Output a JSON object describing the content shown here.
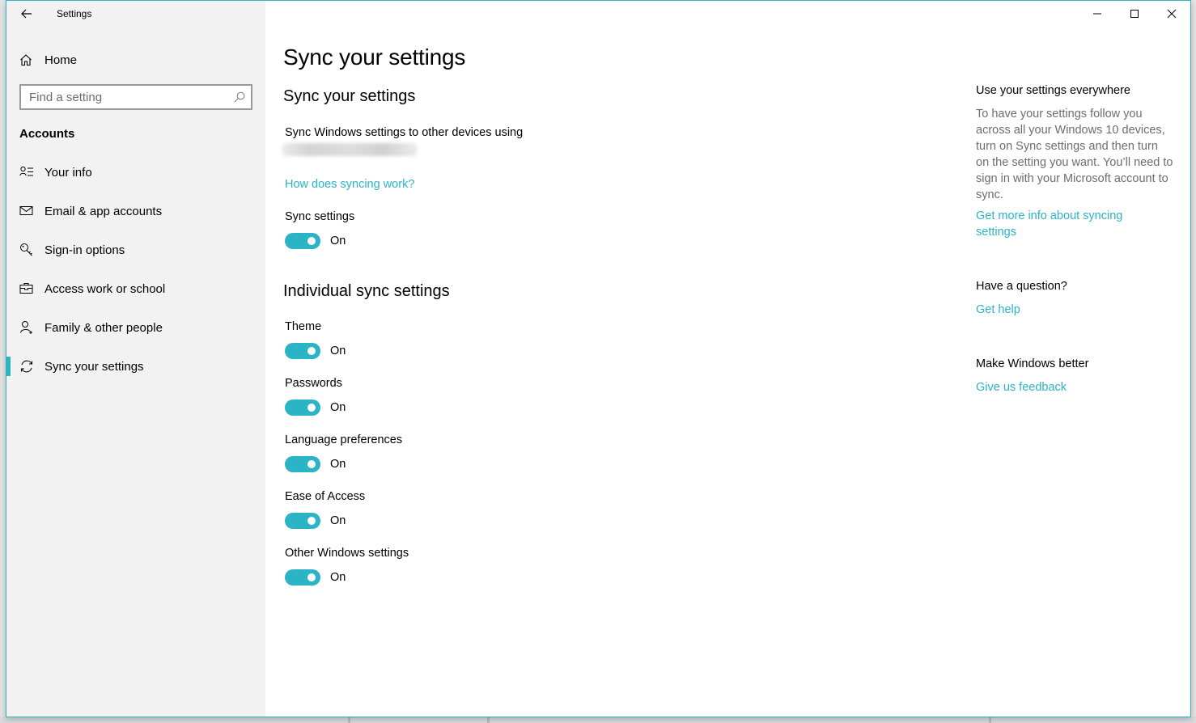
{
  "window": {
    "title": "Settings",
    "controls": {
      "minimize": "minimize-icon",
      "maximize": "maximize-icon",
      "close": "close-icon"
    }
  },
  "colors": {
    "accent": "#2bb3c6",
    "sidebar_bg": "#f2f2f2",
    "secondary_text": "#6d6d6d"
  },
  "sidebar": {
    "home_label": "Home",
    "search_placeholder": "Find a setting",
    "section_label": "Accounts",
    "items": [
      {
        "label": "Your info",
        "icon": "person-list-icon",
        "active": false
      },
      {
        "label": "Email & app accounts",
        "icon": "envelope-icon",
        "active": false
      },
      {
        "label": "Sign-in options",
        "icon": "key-icon",
        "active": false
      },
      {
        "label": "Access work or school",
        "icon": "briefcase-icon",
        "active": false
      },
      {
        "label": "Family & other people",
        "icon": "person-add-icon",
        "active": false
      },
      {
        "label": "Sync your settings",
        "icon": "sync-icon",
        "active": true
      }
    ]
  },
  "main": {
    "page_title": "Sync your settings",
    "sync_section": {
      "heading": "Sync your settings",
      "description": "Sync Windows settings to other devices using",
      "account_email": "[redacted / blurred]",
      "help_link": "How does syncing work?",
      "sync_settings": {
        "label": "Sync settings",
        "state": "On",
        "on": true
      }
    },
    "individual_section": {
      "heading": "Individual sync settings",
      "items": [
        {
          "label": "Theme",
          "state": "On",
          "on": true
        },
        {
          "label": "Passwords",
          "state": "On",
          "on": true
        },
        {
          "label": "Language preferences",
          "state": "On",
          "on": true
        },
        {
          "label": "Ease of Access",
          "state": "On",
          "on": true
        },
        {
          "label": "Other Windows settings",
          "state": "On",
          "on": true
        }
      ]
    }
  },
  "aside": {
    "use_everywhere": {
      "heading": "Use your settings everywhere",
      "description": "To have your settings follow you across all your Windows 10 devices, turn on Sync settings and then turn on the setting you want. You’ll need to sign in with your Microsoft account to sync.",
      "link": "Get more info about syncing settings"
    },
    "question": {
      "heading": "Have a question?",
      "link": "Get help"
    },
    "feedback": {
      "heading": "Make Windows better",
      "link": "Give us feedback"
    }
  }
}
